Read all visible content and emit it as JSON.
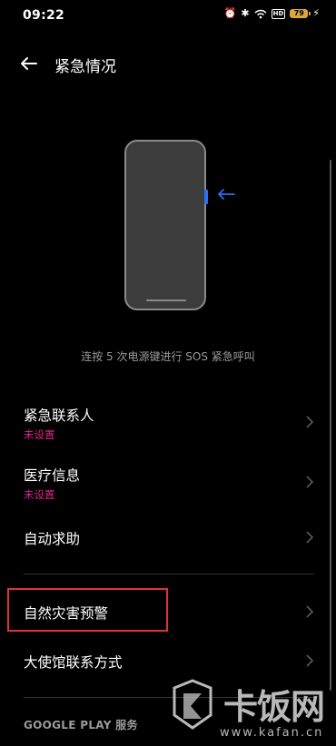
{
  "status_bar": {
    "time": "09:22",
    "alarm_icon": "alarm-icon",
    "bluetooth_icon": "bluetooth-icon",
    "wifi_icon": "wifi-icon",
    "hd_label": "HD",
    "battery_level": "79",
    "charging_icon": "charging-icon"
  },
  "header": {
    "title": "紧急情况",
    "back_icon": "back-arrow-icon"
  },
  "illustration": {
    "caption": "连按 5 次电源键进行 SOS 紧急呼叫",
    "accent_color": "#2f6ff0"
  },
  "list": {
    "items": [
      {
        "title": "紧急联系人",
        "subtitle": "未设置"
      },
      {
        "title": "医疗信息",
        "subtitle": "未设置"
      },
      {
        "title": "自动求助"
      },
      {
        "title": "自然灾害预警",
        "highlighted": true
      },
      {
        "title": "大使馆联系方式"
      }
    ],
    "subtitle_color": "#e0218a"
  },
  "section": {
    "google_play_label": "GOOGLE PLAY 服务"
  },
  "watermark": {
    "text": "卡饭网",
    "url": "www.kafan.cn"
  }
}
